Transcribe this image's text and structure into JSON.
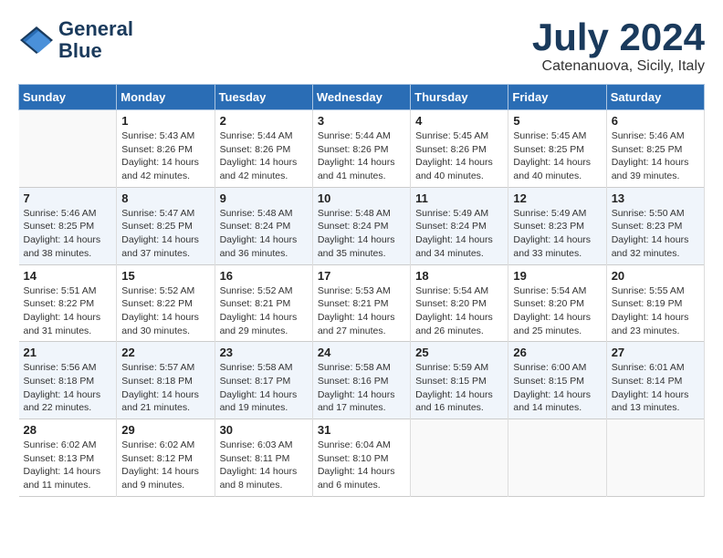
{
  "header": {
    "logo": {
      "line1": "General",
      "line2": "Blue"
    },
    "title": "July 2024",
    "location": "Catenanuova, Sicily, Italy"
  },
  "days_of_week": [
    "Sunday",
    "Monday",
    "Tuesday",
    "Wednesday",
    "Thursday",
    "Friday",
    "Saturday"
  ],
  "weeks": [
    [
      {
        "day": "",
        "info": ""
      },
      {
        "day": "1",
        "info": "Sunrise: 5:43 AM\nSunset: 8:26 PM\nDaylight: 14 hours\nand 42 minutes."
      },
      {
        "day": "2",
        "info": "Sunrise: 5:44 AM\nSunset: 8:26 PM\nDaylight: 14 hours\nand 42 minutes."
      },
      {
        "day": "3",
        "info": "Sunrise: 5:44 AM\nSunset: 8:26 PM\nDaylight: 14 hours\nand 41 minutes."
      },
      {
        "day": "4",
        "info": "Sunrise: 5:45 AM\nSunset: 8:26 PM\nDaylight: 14 hours\nand 40 minutes."
      },
      {
        "day": "5",
        "info": "Sunrise: 5:45 AM\nSunset: 8:25 PM\nDaylight: 14 hours\nand 40 minutes."
      },
      {
        "day": "6",
        "info": "Sunrise: 5:46 AM\nSunset: 8:25 PM\nDaylight: 14 hours\nand 39 minutes."
      }
    ],
    [
      {
        "day": "7",
        "info": "Sunrise: 5:46 AM\nSunset: 8:25 PM\nDaylight: 14 hours\nand 38 minutes."
      },
      {
        "day": "8",
        "info": "Sunrise: 5:47 AM\nSunset: 8:25 PM\nDaylight: 14 hours\nand 37 minutes."
      },
      {
        "day": "9",
        "info": "Sunrise: 5:48 AM\nSunset: 8:24 PM\nDaylight: 14 hours\nand 36 minutes."
      },
      {
        "day": "10",
        "info": "Sunrise: 5:48 AM\nSunset: 8:24 PM\nDaylight: 14 hours\nand 35 minutes."
      },
      {
        "day": "11",
        "info": "Sunrise: 5:49 AM\nSunset: 8:24 PM\nDaylight: 14 hours\nand 34 minutes."
      },
      {
        "day": "12",
        "info": "Sunrise: 5:49 AM\nSunset: 8:23 PM\nDaylight: 14 hours\nand 33 minutes."
      },
      {
        "day": "13",
        "info": "Sunrise: 5:50 AM\nSunset: 8:23 PM\nDaylight: 14 hours\nand 32 minutes."
      }
    ],
    [
      {
        "day": "14",
        "info": "Sunrise: 5:51 AM\nSunset: 8:22 PM\nDaylight: 14 hours\nand 31 minutes."
      },
      {
        "day": "15",
        "info": "Sunrise: 5:52 AM\nSunset: 8:22 PM\nDaylight: 14 hours\nand 30 minutes."
      },
      {
        "day": "16",
        "info": "Sunrise: 5:52 AM\nSunset: 8:21 PM\nDaylight: 14 hours\nand 29 minutes."
      },
      {
        "day": "17",
        "info": "Sunrise: 5:53 AM\nSunset: 8:21 PM\nDaylight: 14 hours\nand 27 minutes."
      },
      {
        "day": "18",
        "info": "Sunrise: 5:54 AM\nSunset: 8:20 PM\nDaylight: 14 hours\nand 26 minutes."
      },
      {
        "day": "19",
        "info": "Sunrise: 5:54 AM\nSunset: 8:20 PM\nDaylight: 14 hours\nand 25 minutes."
      },
      {
        "day": "20",
        "info": "Sunrise: 5:55 AM\nSunset: 8:19 PM\nDaylight: 14 hours\nand 23 minutes."
      }
    ],
    [
      {
        "day": "21",
        "info": "Sunrise: 5:56 AM\nSunset: 8:18 PM\nDaylight: 14 hours\nand 22 minutes."
      },
      {
        "day": "22",
        "info": "Sunrise: 5:57 AM\nSunset: 8:18 PM\nDaylight: 14 hours\nand 21 minutes."
      },
      {
        "day": "23",
        "info": "Sunrise: 5:58 AM\nSunset: 8:17 PM\nDaylight: 14 hours\nand 19 minutes."
      },
      {
        "day": "24",
        "info": "Sunrise: 5:58 AM\nSunset: 8:16 PM\nDaylight: 14 hours\nand 17 minutes."
      },
      {
        "day": "25",
        "info": "Sunrise: 5:59 AM\nSunset: 8:15 PM\nDaylight: 14 hours\nand 16 minutes."
      },
      {
        "day": "26",
        "info": "Sunrise: 6:00 AM\nSunset: 8:15 PM\nDaylight: 14 hours\nand 14 minutes."
      },
      {
        "day": "27",
        "info": "Sunrise: 6:01 AM\nSunset: 8:14 PM\nDaylight: 14 hours\nand 13 minutes."
      }
    ],
    [
      {
        "day": "28",
        "info": "Sunrise: 6:02 AM\nSunset: 8:13 PM\nDaylight: 14 hours\nand 11 minutes."
      },
      {
        "day": "29",
        "info": "Sunrise: 6:02 AM\nSunset: 8:12 PM\nDaylight: 14 hours\nand 9 minutes."
      },
      {
        "day": "30",
        "info": "Sunrise: 6:03 AM\nSunset: 8:11 PM\nDaylight: 14 hours\nand 8 minutes."
      },
      {
        "day": "31",
        "info": "Sunrise: 6:04 AM\nSunset: 8:10 PM\nDaylight: 14 hours\nand 6 minutes."
      },
      {
        "day": "",
        "info": ""
      },
      {
        "day": "",
        "info": ""
      },
      {
        "day": "",
        "info": ""
      }
    ]
  ]
}
